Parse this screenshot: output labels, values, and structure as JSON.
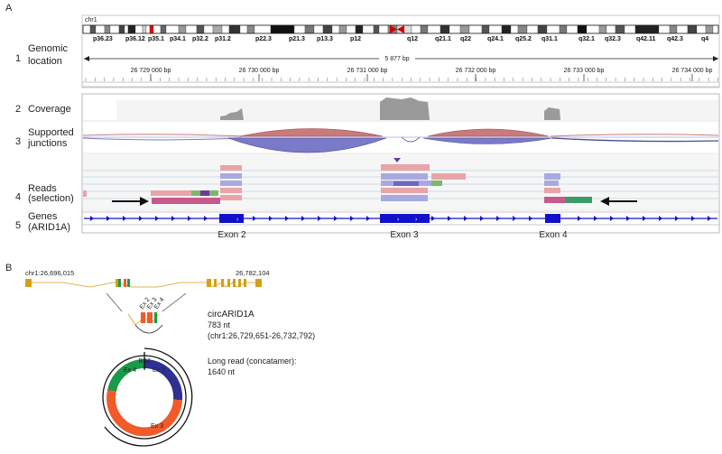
{
  "panels": {
    "a": "A",
    "b": "B"
  },
  "igv": {
    "chromosome": "chr1",
    "bands": [
      "p36.23",
      "p36.12",
      "p35.1",
      "p34.1",
      "p32.2",
      "p31.2",
      "p22.3",
      "p21.3",
      "p13.3",
      "p12",
      "q12",
      "q21.1",
      "q22",
      "q24.1",
      "q25.2",
      "q31.1",
      "q32.1",
      "q32.3",
      "q42.11",
      "q42.3",
      "q4"
    ],
    "span": "5 877 bp",
    "ruler_ticks": [
      "26 729 000 bp",
      "26 730 000 bp",
      "26 731 000 bp",
      "26 732 000 bp",
      "26 733 000 bp",
      "26 734 000 bp"
    ]
  },
  "tracks": [
    {
      "num": "1",
      "lines": [
        "Genomic",
        "location"
      ]
    },
    {
      "num": "2",
      "lines": [
        "Coverage"
      ]
    },
    {
      "num": "3",
      "lines": [
        "Supported",
        "junctions"
      ]
    },
    {
      "num": "4",
      "lines": [
        "Reads",
        "(selection)"
      ]
    },
    {
      "num": "5",
      "lines": [
        "Genes",
        "(ARID1A)"
      ]
    }
  ],
  "exons": [
    "Exon 2",
    "Exon 3",
    "Exon 4"
  ],
  "panel_b": {
    "gene_start": "chr1:26,696,015",
    "gene_end": "26,782,104",
    "mini_exons": [
      "Ex 2",
      "Ex 3",
      "Ex 4"
    ],
    "circ_name": "circARID1A",
    "circ_length": "783 nt",
    "circ_coords": "(chr1:26,729,651-26,732,792)",
    "long_read_title": "Long read (concatamer):",
    "long_read_length": "1640 nt",
    "bsj": "BSJ",
    "ring_ex4": "Ex 4",
    "ring_ex2": "Ex 2",
    "ring_ex3": "Ex 3"
  },
  "colors": {
    "exon2": "#2e3192",
    "exon3": "#f15a29",
    "exon4": "#1a9a4a",
    "gene_track": "#1111cc",
    "arc_up": "#c97a7a",
    "arc_down": "#7a7ac9",
    "gene_model": "#d4a017"
  }
}
